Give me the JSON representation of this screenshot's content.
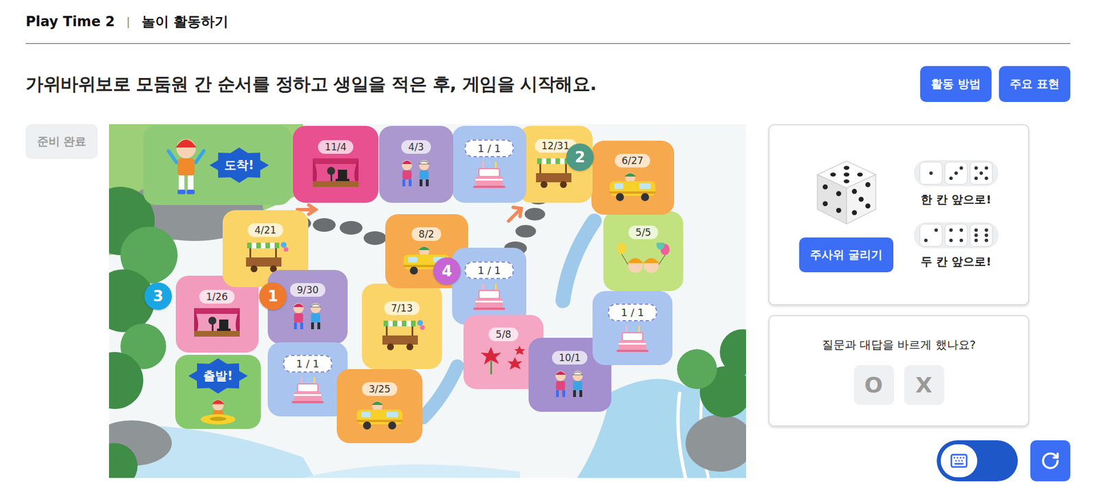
{
  "header": {
    "title": "Play Time 2",
    "separator": "|",
    "subtitle": "놀이 활동하기"
  },
  "instruction": "가위바위보로 모둠원 간 순서를 정하고 생일을 적은 후, 게임을 시작해요.",
  "top_buttons": [
    "활동 방법",
    "주요 표현"
  ],
  "ready_button": {
    "label": "준비 완료",
    "disabled": true
  },
  "board": {
    "tiles": [
      {
        "kind": "start",
        "label": "출발!",
        "color": "#86c96c"
      },
      {
        "kind": "date",
        "label": "1/26",
        "color": "#f39bbd"
      },
      {
        "kind": "date",
        "label": "4/21",
        "color": "#fbd468"
      },
      {
        "kind": "date",
        "label": "9/30",
        "color": "#aa98cf"
      },
      {
        "kind": "blank",
        "label": "1 / 1",
        "color": "#a9c4ef"
      },
      {
        "kind": "date",
        "label": "3/25",
        "color": "#f7a94e"
      },
      {
        "kind": "date",
        "label": "7/13",
        "color": "#fbd468"
      },
      {
        "kind": "date",
        "label": "8/2",
        "color": "#f7a94e"
      },
      {
        "kind": "blank",
        "label": "1 / 1",
        "color": "#a9c4ef"
      },
      {
        "kind": "date",
        "label": "5/8",
        "color": "#f5a6c3"
      },
      {
        "kind": "date",
        "label": "10/1",
        "color": "#a48fcf"
      },
      {
        "kind": "blank",
        "label": "1 / 1",
        "color": "#a9c4ef"
      },
      {
        "kind": "date",
        "label": "5/5",
        "color": "#c2e27f"
      },
      {
        "kind": "date",
        "label": "6/27",
        "color": "#f7a94e"
      },
      {
        "kind": "date",
        "label": "12/31",
        "color": "#fbd468"
      },
      {
        "kind": "blank",
        "label": "1 / 1",
        "color": "#a9c4ef"
      },
      {
        "kind": "date",
        "label": "4/3",
        "color": "#aa98cf"
      },
      {
        "kind": "date",
        "label": "11/4",
        "color": "#e8508f"
      },
      {
        "kind": "finish",
        "label": "도착!",
        "color": "#8fcb76"
      }
    ],
    "players": [
      {
        "label": "1",
        "color": "#ef7a2d"
      },
      {
        "label": "2",
        "color": "#4f9a84"
      },
      {
        "label": "3",
        "color": "#19a6e3"
      },
      {
        "label": "4",
        "color": "#c865d3"
      }
    ]
  },
  "dice_panel": {
    "roll_button": "주사위 굴리기",
    "rules": [
      {
        "pips": [
          1,
          3,
          5
        ],
        "label": "한 칸 앞으로!"
      },
      {
        "pips": [
          2,
          4,
          6
        ],
        "label": "두 칸 앞으로!"
      }
    ]
  },
  "check_panel": {
    "question": "질문과 대답을 바르게 했나요?",
    "options": [
      {
        "label": "O",
        "selected": false
      },
      {
        "label": "X",
        "selected": false
      }
    ]
  },
  "keyboard_toggle": {
    "on": true
  }
}
